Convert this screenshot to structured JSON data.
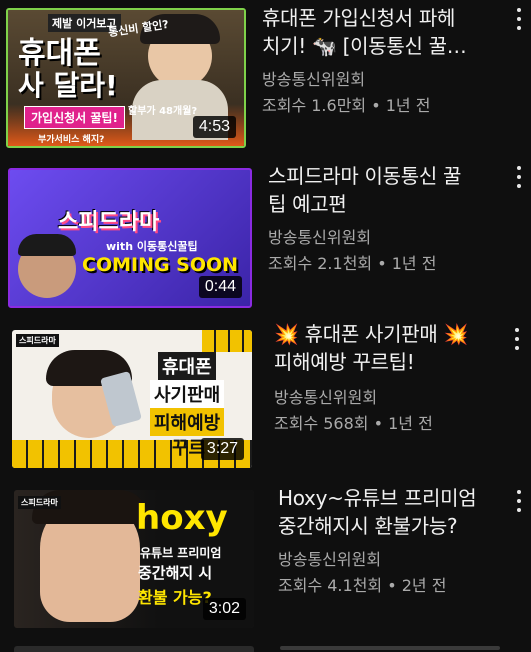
{
  "videos": [
    {
      "title_line1": "휴대폰 가입신청서 파헤",
      "title_line2": "치기! 🐄 [이동통신 꿀…",
      "channel": "방송통신위원회",
      "meta": "조회수 1.6만회 • 1년 전",
      "duration": "4:53",
      "thumb_texts": [
        "제발 이거보고",
        "휴대폰",
        "사 달라!",
        "가입신청서 꿀팁!",
        "통신비 할인?",
        "할부가 48개월?",
        "부가서비스 해지?"
      ]
    },
    {
      "title_line1": "스피드라마 이동통신 꿀",
      "title_line2": "팁 예고편",
      "channel": "방송통신위원회",
      "meta": "조회수 2.1천회 • 1년 전",
      "duration": "0:44",
      "thumb_texts": [
        "스피드라마",
        "with 이동통신꿀팁",
        "COMING SOON"
      ]
    },
    {
      "title_line1": "💥 휴대폰 사기판매 💥",
      "title_line2": "피해예방 꾸르팁!",
      "channel": "방송통신위원회",
      "meta": "조회수 568회 • 1년 전",
      "duration": "3:27",
      "thumb_texts": [
        "스피드라마",
        "휴대폰",
        "사기판매",
        "피해예방",
        "꾸르"
      ]
    },
    {
      "title_line1": "Hoxy~유튜브 프리미엄",
      "title_line2": "중간해지시 환불가능?",
      "channel": "방송통신위원회",
      "meta": "조회수 4.1천회 • 2년 전",
      "duration": "3:02",
      "thumb_texts": [
        "스피드라마",
        "hoxy",
        "유튜브 프리미엄",
        "중간해지 시",
        "환불 가능?"
      ]
    }
  ]
}
